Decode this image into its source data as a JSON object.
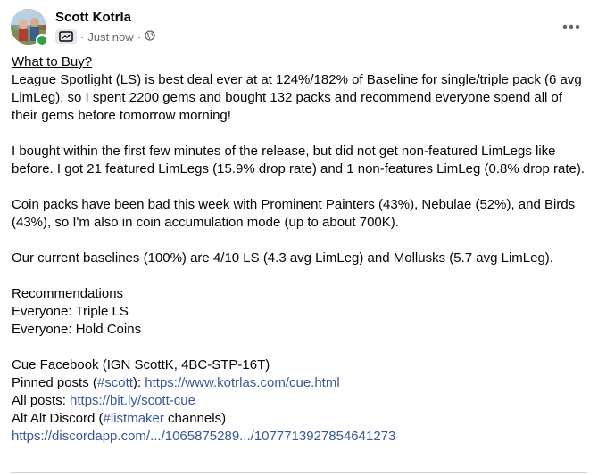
{
  "post": {
    "author": "Scott Kotrla",
    "timestamp": "Just now",
    "separator": "·",
    "audience_icon": "globe-icon",
    "more_icon": "more-options-icon"
  },
  "body": {
    "heading1": "What to Buy?",
    "para1": "League Spotlight (LS) is best deal ever at at 124%/182% of Baseline for single/triple pack (6 avg LimLeg), so I spent 2200 gems and bought 132 packs and recommend everyone spend all of their gems before tomorrow morning!",
    "para2": "I bought within the first few minutes of the release, but did not get non-featured LimLegs like before. I got 21 featured LimLegs (15.9% drop rate) and 1 non-features LimLeg (0.8% drop rate).",
    "para3": "Coin packs have been bad this week with Prominent Painters (43%), Nebulae (52%), and Birds (43%), so I'm also in coin accumulation mode (up to about 700K).",
    "para4": "Our current baselines (100%) are 4/10 LS (4.3 avg LimLeg) and Mollusks (5.7 avg LimLeg).",
    "heading2": "Recommendations",
    "rec1": "Everyone: Triple LS",
    "rec2": "Everyone: Hold Coins",
    "footer1": "Cue Facebook (IGN ScottK, 4BC-STP-16T)",
    "pinned_prefix": "Pinned posts (",
    "pinned_tag": "#scott",
    "pinned_mid": "): ",
    "pinned_url": "https://www.kotrlas.com/cue.html",
    "allposts_prefix": "All posts: ",
    "allposts_url": "https://bit.ly/scott-cue",
    "discord_prefix": "Alt Alt Discord (",
    "discord_tag": "#listmaker",
    "discord_suffix": " channels)",
    "discord_url": "https://discordapp.com/.../1065875289.../1077713927854641273"
  },
  "colors": {
    "link": "#385898",
    "meta_text": "#65676b",
    "online": "#31a24c"
  }
}
